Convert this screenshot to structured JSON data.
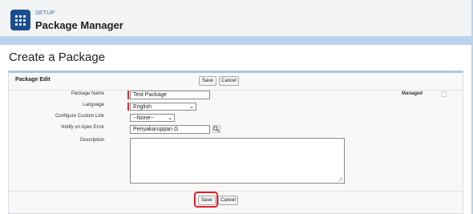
{
  "header": {
    "breadcrumb": "SETUP",
    "title": "Package Manager",
    "icon": "grid-icon"
  },
  "page": {
    "title": "Create a Package"
  },
  "section": {
    "title": "Package Edit",
    "save_label": "Save",
    "cancel_label": "Cancel"
  },
  "form": {
    "package_name_label": "Package Name",
    "package_name_value": "Test Package",
    "language_label": "Language",
    "language_value": "English",
    "custom_link_label": "Configure Custom Link",
    "custom_link_value": "--None--",
    "notify_label": "Notify on Apex Error",
    "notify_value": "Periyakaruppan  G",
    "description_label": "Description",
    "description_value": "",
    "managed_label": "Managed",
    "managed_checked": false
  },
  "footer": {
    "save_label": "Save",
    "cancel_label": "Cancel"
  },
  "colors": {
    "header_icon": "#1b4e8f",
    "required_marker": "#c23934",
    "highlight": "#e52020",
    "background": "#b9d3ec"
  }
}
